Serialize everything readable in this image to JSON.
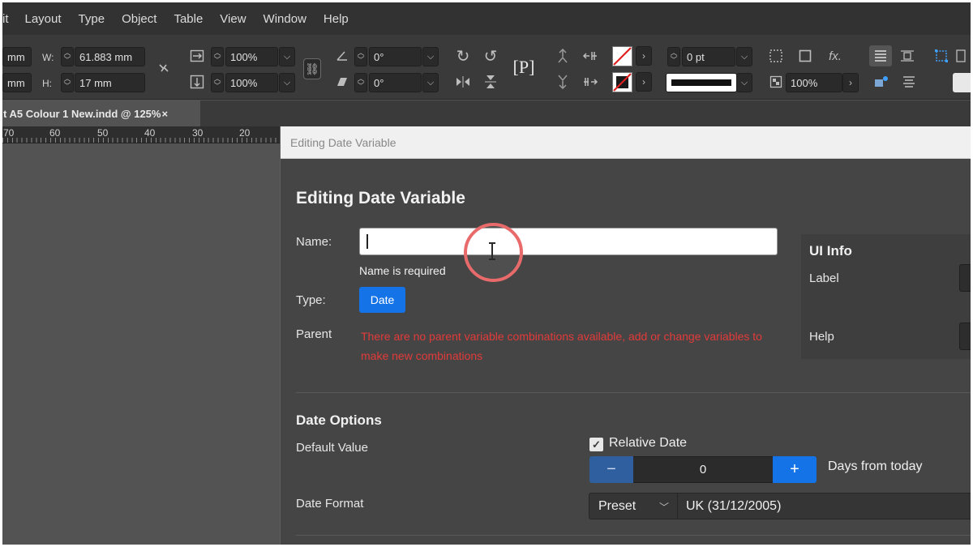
{
  "menubar": {
    "items": [
      "it",
      "Layout",
      "Type",
      "Object",
      "Table",
      "View",
      "Window",
      "Help"
    ]
  },
  "controlbar": {
    "x_value": "mm",
    "y_value": "mm",
    "w_label": "W:",
    "w_value": "61.883 mm",
    "h_label": "H:",
    "h_value": "17 mm",
    "scale_x": "100%",
    "scale_y": "100%",
    "rotate_angle": "0°",
    "shear_angle": "0°",
    "stroke_weight": "0 pt",
    "opacity": "100%"
  },
  "doctab": {
    "title": "t A5 Colour 1 New.indd @ 125%",
    "close": "×"
  },
  "ruler": {
    "ticks": [
      "70",
      "60",
      "50",
      "40",
      "30",
      "20"
    ]
  },
  "dialog": {
    "window_title": "Editing Date Variable",
    "heading": "Editing Date Variable",
    "name_label": "Name:",
    "name_value": "",
    "name_error": "Name is required",
    "type_label": "Type:",
    "type_button": "Date",
    "parent_label": "Parent",
    "parent_error": "There are no parent variable combinations available, add or change variables to make new combinations",
    "ui_info": {
      "title": "UI Info",
      "label": "Label",
      "help": "Help"
    },
    "date_options": {
      "heading": "Date Options",
      "default_value_label": "Default Value",
      "relative_date_label": "Relative Date",
      "relative_date_checked": true,
      "days_value": "0",
      "minus": "−",
      "plus": "+",
      "days_suffix": "Days from today",
      "date_format_label": "Date Format",
      "preset_value": "Preset",
      "format_value": "UK (31/12/2005)"
    }
  },
  "colors": {
    "accent": "#1473e6",
    "error": "#e33a3a",
    "cursor_ring": "#e86a6a"
  }
}
